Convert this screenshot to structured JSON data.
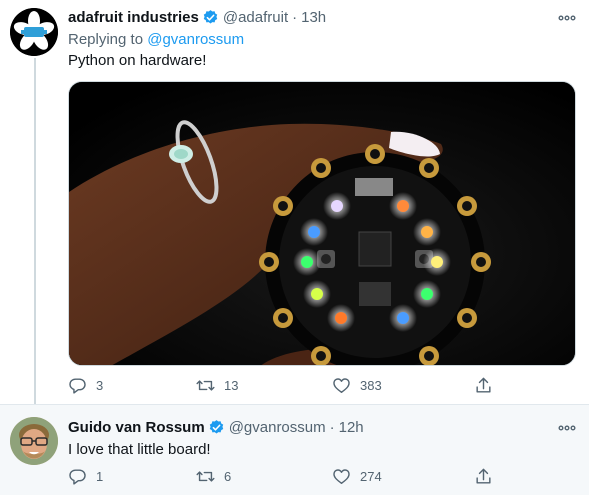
{
  "colors": {
    "link": "#1d9bf0",
    "secondary_text": "#536471",
    "verified": "#1d9bf0",
    "reply_bg": "#f5f8fa"
  },
  "tweets": [
    {
      "name": "adafruit industries",
      "handle": "@adafruit",
      "separator": "·",
      "time": "13h",
      "replying_prefix": "Replying to ",
      "replying_to": "@gvanrossum",
      "text": "Python on hardware!",
      "media_icon": "circuit-playground-board-photo",
      "counts": {
        "replies": "3",
        "retweets": "13",
        "likes": "383"
      }
    },
    {
      "name": "Guido van Rossum",
      "handle": "@gvanrossum",
      "separator": "·",
      "time": "12h",
      "text": "I love that little board!",
      "counts": {
        "replies": "1",
        "retweets": "6",
        "likes": "274"
      }
    }
  ]
}
